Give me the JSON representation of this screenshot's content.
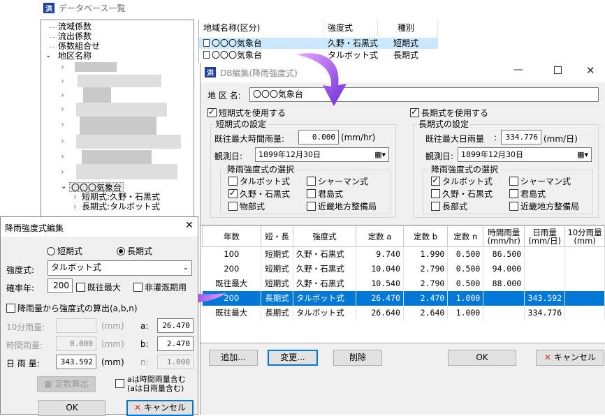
{
  "main_window": {
    "title": "データベース一覧",
    "tree": {
      "items": [
        "流域係数",
        "流出係数",
        "係数組合せ",
        "地区名称"
      ],
      "selected_station": "〇〇〇気象台",
      "children": [
        "短期式:久野・石黒式",
        "長期式:タルボット式"
      ]
    },
    "list": {
      "headers": [
        "地域名称(区分)",
        "強度式",
        "種別"
      ],
      "rows": [
        {
          "name": "〇〇〇気象台",
          "formula": "久野・石黒式",
          "type": "短期式"
        },
        {
          "name": "〇〇〇気象台",
          "formula": "タルボット式",
          "type": "長期式"
        }
      ]
    }
  },
  "db_edit": {
    "title": "DB編集(降雨強度式)",
    "district_label": "地 区 名:",
    "district_value": "〇〇〇気象台",
    "short": {
      "use_label": "短期式を使用する",
      "settings_label": "短期式の設定",
      "rain_label": "既往最大時間雨量:",
      "rain_value": "0.000",
      "rain_unit": "(mm/hr)",
      "date_label": "観測日:",
      "date_value": "1899年12月30日",
      "select_label": "降雨強度式の選択",
      "options": [
        {
          "label": "タルボット式",
          "checked": false
        },
        {
          "label": "シャーマン式",
          "checked": false
        },
        {
          "label": "久野・石黒式",
          "checked": true
        },
        {
          "label": "君島式",
          "checked": false
        },
        {
          "label": "物部式",
          "checked": false
        },
        {
          "label": "近畿地方整備局",
          "checked": false
        }
      ]
    },
    "long": {
      "use_label": "長期式を使用する",
      "settings_label": "長期式の設定",
      "rain_label": "既往最大日雨量",
      "rain_value": "334.776",
      "rain_unit": "(mm/日)",
      "date_label": "観測日:",
      "date_value": "1899年12月30日",
      "select_label": "降雨強度式の選択",
      "options": [
        {
          "label": "タルボット式",
          "checked": true
        },
        {
          "label": "シャーマン式",
          "checked": false
        },
        {
          "label": "久野・石黒式",
          "checked": false
        },
        {
          "label": "君島式",
          "checked": false
        },
        {
          "label": "長部式",
          "checked": false
        },
        {
          "label": "近畿地方整備局",
          "checked": false
        }
      ]
    },
    "table": {
      "headers": [
        "年数",
        "短・長",
        "強度式",
        "定数 a",
        "定数 b",
        "定数 n",
        "時間雨量\n(mm/hr)",
        "日雨量\n(mm/日)",
        "10分雨量\n(mm)"
      ],
      "rows": [
        [
          "100",
          "短期式",
          "久野・石黒式",
          "9.740",
          "1.990",
          "0.500",
          "86.500",
          "",
          ""
        ],
        [
          "200",
          "短期式",
          "久野・石黒式",
          "10.040",
          "2.790",
          "0.500",
          "94.000",
          "",
          ""
        ],
        [
          "既往最大",
          "短期式",
          "久野・石黒式",
          "10.540",
          "2.790",
          "0.500",
          "88.000",
          "",
          ""
        ],
        [
          "200",
          "長期式",
          "タルボット式",
          "26.470",
          "2.470",
          "1.000",
          "",
          "343.592",
          ""
        ],
        [
          "既往最大",
          "長期式",
          "タルボット式",
          "26.640",
          "2.640",
          "1.000",
          "",
          "334.776",
          ""
        ]
      ],
      "selected_row": 3
    },
    "buttons": {
      "add": "追加...",
      "change": "変更...",
      "delete": "削除",
      "ok": "OK",
      "cancel": "キャンセル"
    }
  },
  "rate_dialog": {
    "title": "降雨強度式編集",
    "radio_short": "短期式",
    "radio_long": "長期式",
    "formula_label": "強度式:",
    "formula_value": "タルボット式",
    "prob_label": "確率年:",
    "prob_value": "200",
    "past_max_label": "既往最大",
    "non_flood_label": "非灌漑期用",
    "calc_check_label": "降雨量から強度式の算出(a,b,n)",
    "ten_min_label": "10分雨量:",
    "hour_label": "時間雨量:",
    "hour_value": "0.000",
    "day_label": "日 雨 量:",
    "day_value": "343.592",
    "unit": "(mm)",
    "a_label": "a:",
    "a_value": "26.470",
    "b_label": "b:",
    "b_value": "2.470",
    "n_label": "n:",
    "n_value": "1.000",
    "calc_button": "定数算出",
    "note_line1": "aは時間雨量含む",
    "note_line2": "(aは日雨量含む)",
    "ok": "OK",
    "cancel": "キャンセル"
  },
  "colors": {
    "selection": "#0078d7",
    "arrow": "#9b3fd6",
    "cancel_x": "#d9342b"
  }
}
